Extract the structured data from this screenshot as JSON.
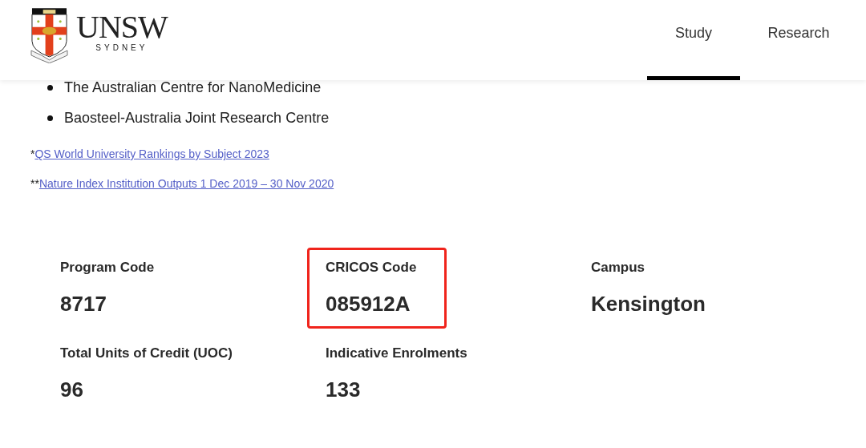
{
  "header": {
    "logo": {
      "wordmark": "UNSW",
      "subtitle": "SYDNEY"
    },
    "nav": [
      {
        "label": "Study",
        "selected": true
      },
      {
        "label": "Research",
        "selected": false
      }
    ]
  },
  "list_items": [
    "The Australian Centre for NanoMedicine",
    "Baosteel-Australia Joint Research Centre"
  ],
  "footnotes": [
    {
      "marker": "*",
      "link": "QS World University Rankings by Subject 2023"
    },
    {
      "marker": "**",
      "link": "Nature Index Institution Outputs 1 Dec 2019 – 30 Nov 2020"
    }
  ],
  "stats": [
    {
      "label": "Program Code",
      "value": "8717",
      "highlighted": false
    },
    {
      "label": "CRICOS Code",
      "value": "085912A",
      "highlighted": true
    },
    {
      "label": "Campus",
      "value": "Kensington",
      "highlighted": false
    },
    {
      "label": "Total Units of Credit (UOC)",
      "value": "96",
      "highlighted": false
    },
    {
      "label": "Indicative Enrolments",
      "value": "133",
      "highlighted": false
    }
  ]
}
